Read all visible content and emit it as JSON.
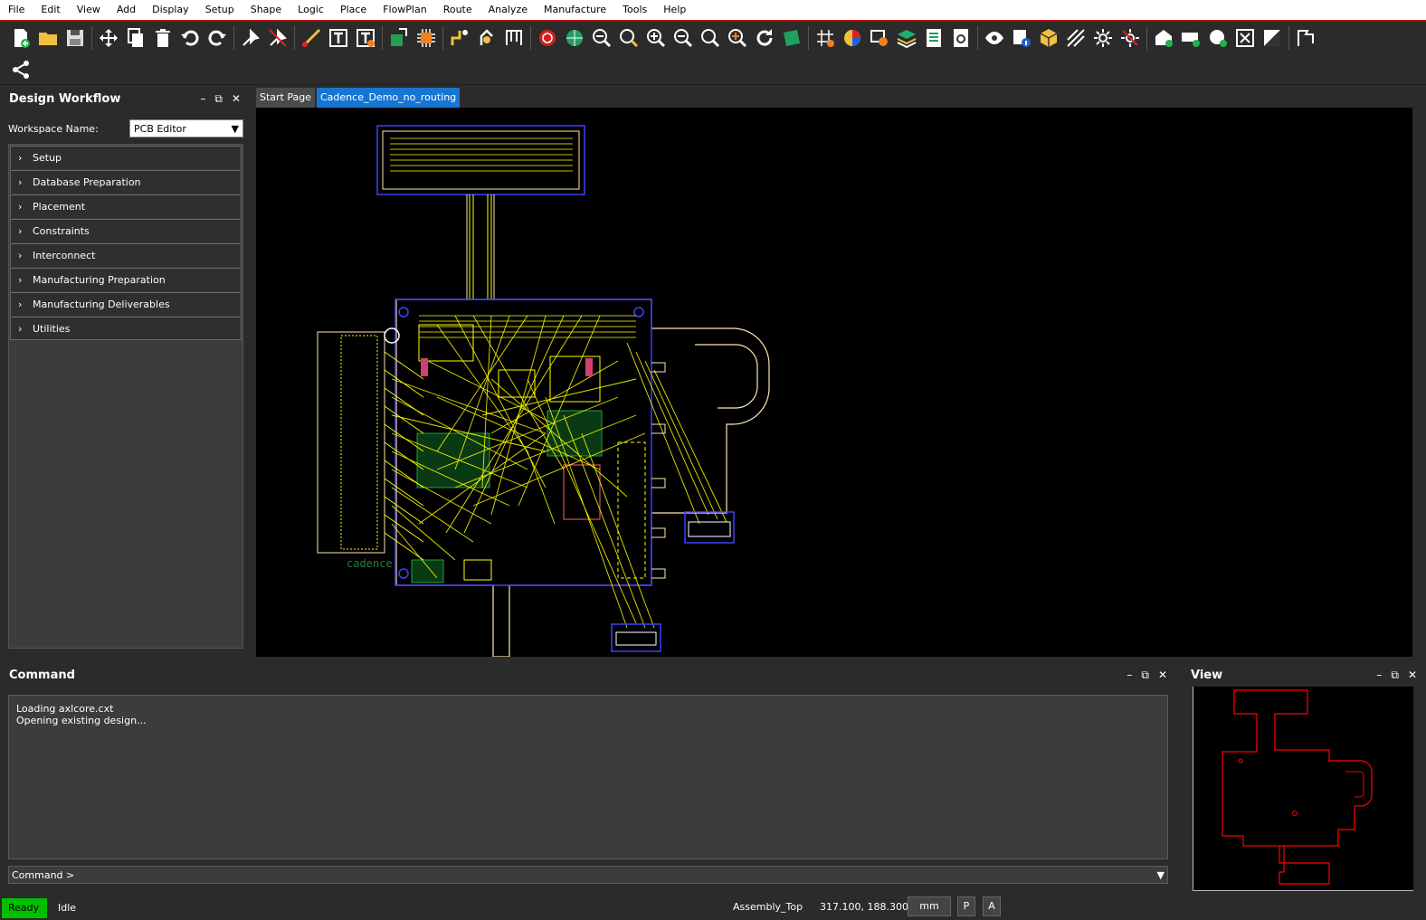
{
  "menu": [
    "File",
    "Edit",
    "View",
    "Add",
    "Display",
    "Setup",
    "Shape",
    "Logic",
    "Place",
    "FlowPlan",
    "Route",
    "Analyze",
    "Manufacture",
    "Tools",
    "Help"
  ],
  "toolbar_icons": [
    "new-icon",
    "open-icon",
    "save-icon",
    "move-icon",
    "copy-icon",
    "delete-icon",
    "undo-icon",
    "redo-icon",
    "pin-icon",
    "unpin-icon",
    "add-connect-icon",
    "text-icon",
    "text-edit-icon",
    "placement-icon",
    "chip-icon",
    "slide-icon",
    "spread-icon",
    "bus-icon",
    "drc-icon",
    "globe-icon",
    "zoom-fit-icon",
    "zoom-window-icon",
    "zoom-in-icon",
    "zoom-out-icon",
    "zoom-world-icon",
    "zoom-center-icon",
    "redraw-icon",
    "board-icon",
    "grid-icon",
    "color-icon",
    "layers-icon",
    "stack-icon",
    "report-icon",
    "settings-icon",
    "visibility-icon",
    "info-icon",
    "3d-icon",
    "shadow-icon",
    "highlight-icon",
    "dehighlight-icon",
    "shape-add-icon",
    "rect-add-icon",
    "circle-add-icon",
    "select-icon",
    "void-icon",
    "flag-icon"
  ],
  "workflow": {
    "title": "Design Workflow",
    "workspace_label": "Workspace Name:",
    "workspace_value": "PCB Editor",
    "items": [
      "Setup",
      "Database Preparation",
      "Placement",
      "Constraints",
      "Interconnect",
      "Manufacturing Preparation",
      "Manufacturing Deliverables",
      "Utilities"
    ]
  },
  "tabs": [
    {
      "label": "Start Page",
      "active": false
    },
    {
      "label": "Cadence_Demo_no_routing",
      "active": true
    }
  ],
  "command": {
    "title": "Command",
    "output": [
      "Loading axlcore.cxt",
      "Opening existing design..."
    ],
    "prompt": "Command >"
  },
  "view_panel": {
    "title": "View"
  },
  "status": {
    "state": "Ready",
    "activity": "Idle",
    "layer": "Assembly_Top",
    "coords": "317.100, 188.300",
    "units": "mm",
    "p": "P",
    "a": "A"
  },
  "colors": {
    "outline": "#ffe6b0",
    "ratsnest": "#ffff00",
    "highlight": "#4040ff",
    "view_outline": "#ff0000",
    "ready": "#00c000",
    "tab_active": "#1677d2"
  }
}
